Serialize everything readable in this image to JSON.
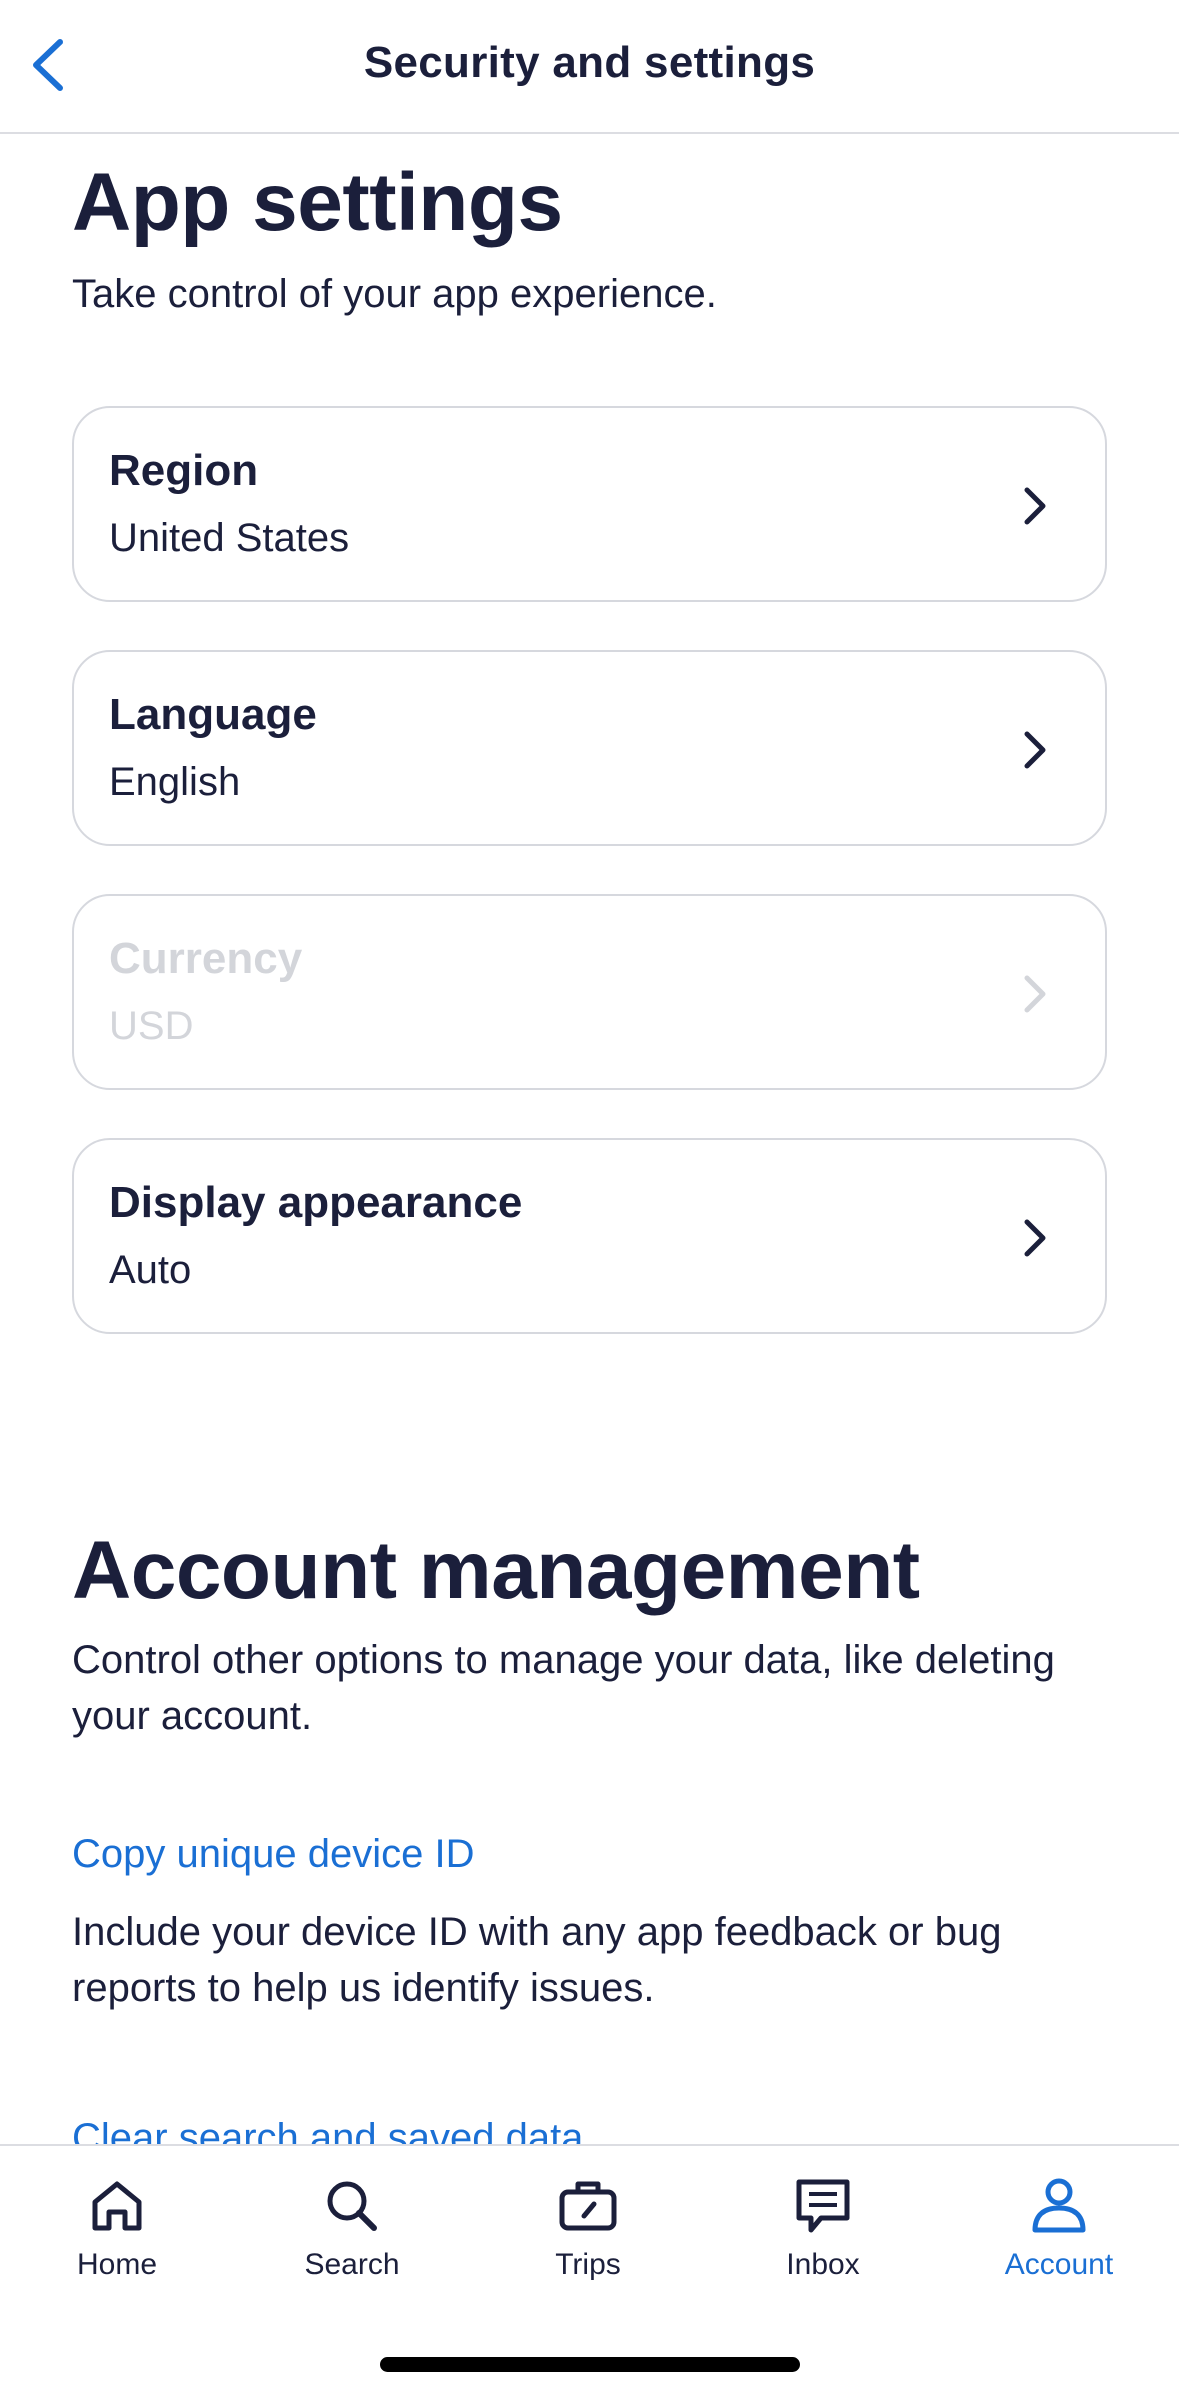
{
  "header": {
    "title": "Security and settings"
  },
  "app_settings": {
    "title": "App settings",
    "subtitle": "Take control of your app experience.",
    "items": [
      {
        "label": "Region",
        "value": "United States"
      },
      {
        "label": "Language",
        "value": "English"
      },
      {
        "label": "Currency",
        "value": "USD"
      },
      {
        "label": "Display appearance",
        "value": "Auto"
      }
    ]
  },
  "account_management": {
    "title": "Account management",
    "subtitle": "Control other options to manage your data, like deleting your account.",
    "copy_id_link": "Copy unique device ID",
    "copy_id_desc": "Include your device ID with any app feedback or bug reports to help us identify issues.",
    "clear_data_link": "Clear search and saved data"
  },
  "tabbar": {
    "items": [
      {
        "label": "Home",
        "icon": "home-icon"
      },
      {
        "label": "Search",
        "icon": "search-icon"
      },
      {
        "label": "Trips",
        "icon": "briefcase-icon"
      },
      {
        "label": "Inbox",
        "icon": "message-icon"
      },
      {
        "label": "Account",
        "icon": "person-icon",
        "active": true
      }
    ]
  },
  "colors": {
    "accent": "#1a6fd4",
    "text": "#1b1f3b",
    "disabled": "#d3d5da",
    "border": "#d6d8de"
  }
}
